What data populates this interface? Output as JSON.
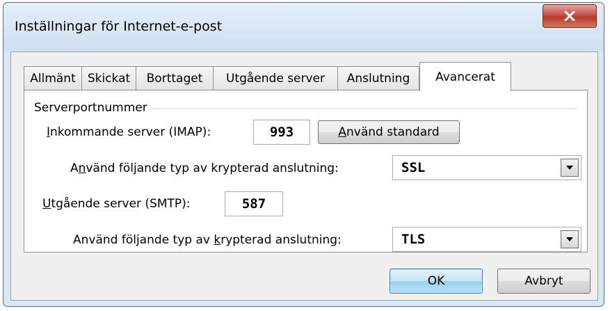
{
  "window": {
    "title": "Inställningar för Internet-e-post"
  },
  "tabs": [
    {
      "label": "Allmänt"
    },
    {
      "label": "Skickat"
    },
    {
      "label": "Borttaget"
    },
    {
      "label": "Utgående server"
    },
    {
      "label": "Anslutning"
    },
    {
      "label": "Avancerat",
      "active": true
    }
  ],
  "server_ports": {
    "group_label": "Serverportnummer",
    "incoming_label": "nkommande server (IMAP):",
    "incoming_label_accel": "I",
    "incoming_port": "993",
    "default_button_accel": "A",
    "default_button_rest": "nvänd standard",
    "incoming_encryption_label_pre": "A",
    "incoming_encryption_label_accel": "n",
    "incoming_encryption_label_post": "vänd följande typ av krypterad anslutning:",
    "incoming_encryption_value": "SSL",
    "outgoing_label_accel": "U",
    "outgoing_label": "tgående server (SMTP):",
    "outgoing_port": "587",
    "outgoing_encryption_label_pre": "Använd följande typ av ",
    "outgoing_encryption_label_accel": "k",
    "outgoing_encryption_label_post": "rypterad anslutning:",
    "outgoing_encryption_value": "TLS"
  },
  "buttons": {
    "ok": "OK",
    "cancel": "Avbryt"
  },
  "icons": {
    "close": "close-icon",
    "dropdown": "chevron-down-icon"
  }
}
